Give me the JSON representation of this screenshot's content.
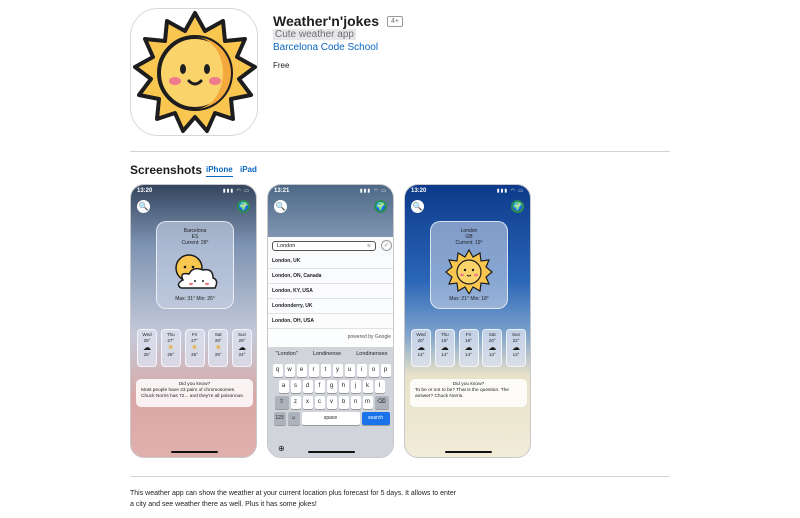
{
  "app": {
    "title": "Weather'n'jokes",
    "age_rating": "4+",
    "subtitle": "Cute weather app",
    "developer": "Barcelona Code School",
    "price": "Free"
  },
  "screenshots": {
    "heading": "Screenshots",
    "tabs": [
      "iPhone",
      "iPad"
    ],
    "active_tab": "iPhone"
  },
  "phone1": {
    "time": "13:20",
    "city": "Barcelona",
    "country": "ES",
    "current": "Current: 28°",
    "minmax": "Max: 31° Min: 26°",
    "forecast": [
      {
        "day": "Wed",
        "hi": "25°",
        "lo": "25°"
      },
      {
        "day": "Thu",
        "hi": "27°",
        "lo": "26°"
      },
      {
        "day": "Fri",
        "hi": "27°",
        "lo": "26°"
      },
      {
        "day": "Sat",
        "hi": "28°",
        "lo": "25°"
      },
      {
        "day": "Sun",
        "hi": "29°",
        "lo": "24°"
      }
    ],
    "joke_title": "Did you know?",
    "joke_text": "Most people have 23 pairs of chromosomes. Chuck Norris has 72... and they're all poisonous."
  },
  "phone2": {
    "time": "13:21",
    "search_value": "London",
    "results": [
      "London, UK",
      "London, ON, Canada",
      "London, KY, USA",
      "Londonderry, UK",
      "London, OH, USA"
    ],
    "powered_by": "powered by Google",
    "suggestions": [
      "\"London\"",
      "Londinense",
      "Londinenses"
    ],
    "keys_row1": [
      "q",
      "w",
      "e",
      "r",
      "t",
      "y",
      "u",
      "i",
      "o",
      "p"
    ],
    "keys_row2": [
      "a",
      "s",
      "d",
      "f",
      "g",
      "h",
      "j",
      "k",
      "l"
    ],
    "keys_row3": [
      "z",
      "x",
      "c",
      "v",
      "b",
      "n",
      "m"
    ],
    "key_numbers": "123",
    "key_space": "space",
    "key_search": "search"
  },
  "phone3": {
    "time": "13:20",
    "city": "London",
    "country": "GB",
    "current": "Current: 19°",
    "minmax": "Max: 21° Min: 18°",
    "forecast": [
      {
        "day": "Wed",
        "hi": "20°",
        "lo": "14°"
      },
      {
        "day": "Thu",
        "hi": "19°",
        "lo": "14°"
      },
      {
        "day": "Fri",
        "hi": "19°",
        "lo": "14°"
      },
      {
        "day": "Sat",
        "hi": "20°",
        "lo": "13°"
      },
      {
        "day": "Sun",
        "hi": "22°",
        "lo": "13°"
      }
    ],
    "joke_title": "Did you know?",
    "joke_text": "To be or not to be? That is the question. The answer? Chuck Norris."
  },
  "description": {
    "line1": "This weather app can show the weather at your current location plus forecast for 5 days. It allows to enter",
    "line2": "a city and see weather there as well. Plus it has some jokes!"
  },
  "colors": {
    "link": "#0a66c2",
    "sun_fill": "#f9c74f",
    "sun_outline": "#1d1d1f"
  }
}
